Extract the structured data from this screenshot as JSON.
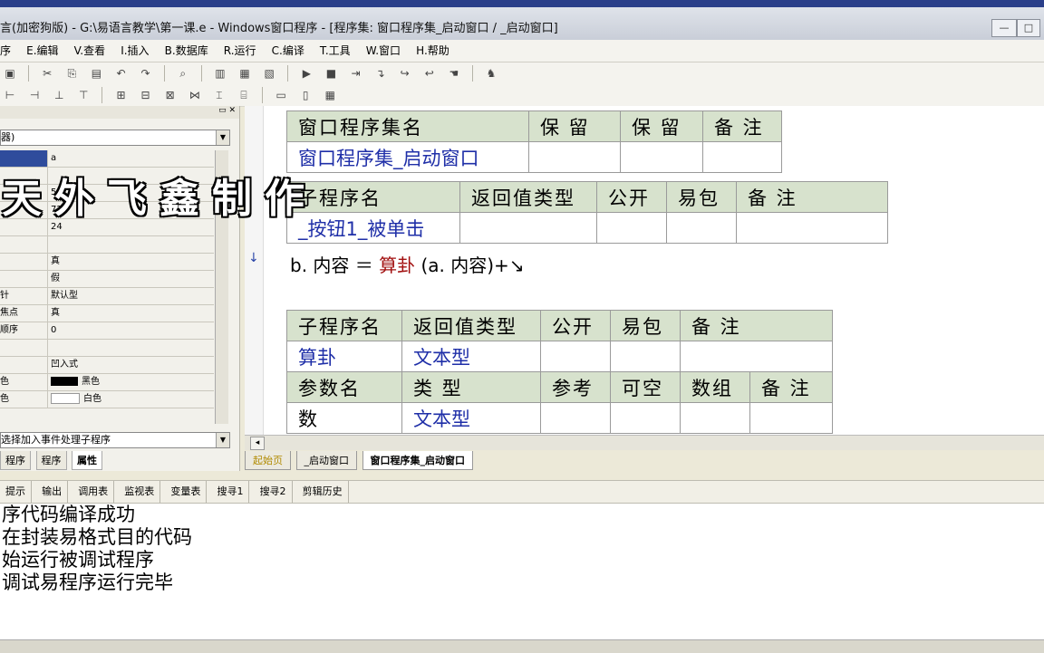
{
  "window": {
    "title": "言(加密狗版) - G:\\易语言教学\\第一课.e - Windows窗口程序 - [程序集: 窗口程序集_启动窗口 / _启动窗口]",
    "min_label": "—",
    "max_label": "□",
    "close_label": "✕"
  },
  "menu": [
    "序",
    "E.编辑",
    "V.查看",
    "I.插入",
    "B.数据库",
    "R.运行",
    "C.编译",
    "T.工具",
    "W.窗口",
    "H.帮助"
  ],
  "toolbar1_icons": [
    "save-icon",
    "cut-icon",
    "copy-icon",
    "paste-icon",
    "undo-icon",
    "redo-icon",
    "find-icon",
    "layout1-icon",
    "layout2-icon",
    "layout3-icon",
    "run-icon",
    "stop-icon",
    "step1-icon",
    "step2-icon",
    "step3-icon",
    "step4-icon",
    "step5-icon",
    "bookmark-icon"
  ],
  "left_panel": {
    "header_btns": "▭ ✕",
    "combo_value": "器)",
    "props": [
      {
        "key": "",
        "value": "a",
        "selected": true
      },
      {
        "key": "",
        "value": ""
      },
      {
        "key": "",
        "value": "50"
      },
      {
        "key": "",
        "value": "72"
      },
      {
        "key": "",
        "value": "24"
      },
      {
        "key": "",
        "value": ""
      },
      {
        "key": "",
        "value": "真"
      },
      {
        "key": "",
        "value": "假"
      },
      {
        "key": "针",
        "value": "默认型"
      },
      {
        "key": "焦点",
        "value": "真"
      },
      {
        "key": "顺序",
        "value": "0"
      },
      {
        "key": "",
        "value": ""
      },
      {
        "key": "",
        "value": "凹入式"
      },
      {
        "key": "色",
        "value": "黑色"
      },
      {
        "key": "色",
        "value": "白色"
      }
    ],
    "event_combo": "选择加入事件处理子程序",
    "tabs": [
      "程序",
      "程序",
      "属性"
    ]
  },
  "editor": {
    "table1": {
      "headers": [
        "窗口程序集名",
        "保 留",
        "保 留",
        "备 注"
      ],
      "row": [
        "窗口程序集_启动窗口",
        "",
        "",
        ""
      ]
    },
    "table2": {
      "headers": [
        "子程序名",
        "返回值类型",
        "公开",
        "易包",
        "备 注"
      ],
      "row": [
        "_按钮1_被单击",
        "",
        "",
        "",
        ""
      ]
    },
    "code_line": {
      "prefix": "b. 内容  ＝  ",
      "func": "算卦",
      "suffix": " (a. 内容)+↘"
    },
    "table3": {
      "headers": [
        "子程序名",
        "返回值类型",
        "公开",
        "易包",
        "备 注"
      ],
      "row": [
        "算卦",
        "文本型",
        "",
        "",
        ""
      ],
      "param_headers": [
        "参数名",
        "类 型",
        "参考",
        "可空",
        "数组",
        "备 注"
      ],
      "param_row": [
        "数",
        "文本型",
        "",
        "",
        "",
        ""
      ]
    },
    "tabs": [
      "起始页",
      "_启动窗口",
      "窗口程序集_启动窗口"
    ]
  },
  "bottom_tabs": [
    "提示",
    "输出",
    "调用表",
    "监视表",
    "变量表",
    "搜寻1",
    "搜寻2",
    "剪辑历史"
  ],
  "output_lines": [
    "序代码编译成功",
    "在封装易格式目的代码",
    "始运行被调试程序",
    "调试易程序运行完毕"
  ],
  "watermark": "天外飞鑫制作"
}
